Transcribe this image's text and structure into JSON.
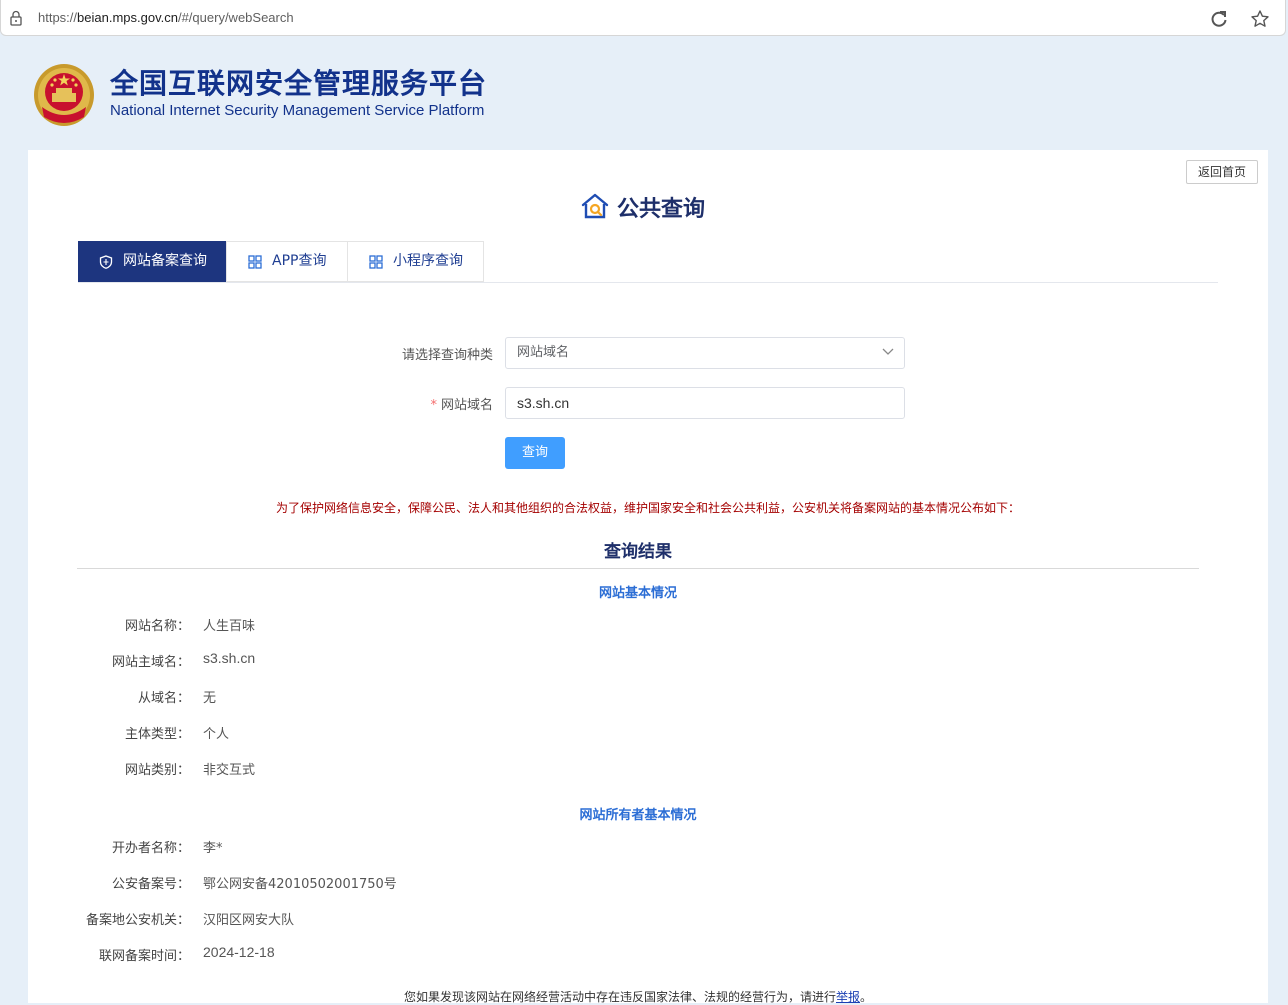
{
  "browser": {
    "url_prefix": "https://",
    "url_host": "beian.mps.gov.cn",
    "url_path": "/#/query/webSearch"
  },
  "header": {
    "title": "全国互联网安全管理服务平台",
    "subtitle": "National Internet Security Management Service Platform"
  },
  "card": {
    "home_button": "返回首页",
    "heading": "公共查询"
  },
  "tabs": [
    {
      "label": "网站备案查询",
      "active": true,
      "icon": "shield-icon"
    },
    {
      "label": "APP查询",
      "active": false,
      "icon": "grid-icon"
    },
    {
      "label": "小程序查询",
      "active": false,
      "icon": "grid-icon"
    }
  ],
  "form": {
    "type_label": "请选择查询种类",
    "type_value": "网站域名",
    "domain_label": "网站域名",
    "domain_required_mark": "*",
    "domain_value": "s3.sh.cn",
    "submit": "查询"
  },
  "notice": "为了保护网络信息安全，保障公民、法人和其他组织的合法权益，维护国家安全和社会公共利益，公安机关将备案网站的基本情况公布如下：",
  "result": {
    "title": "查询结果",
    "website_section": {
      "title": "网站基本情况",
      "rows": [
        {
          "label": "网站名称：",
          "value": "人生百味"
        },
        {
          "label": "网站主域名：",
          "value": "s3.sh.cn"
        },
        {
          "label": "从域名：",
          "value": "无"
        },
        {
          "label": "主体类型：",
          "value": "个人"
        },
        {
          "label": "网站类别：",
          "value": "非交互式"
        }
      ]
    },
    "owner_section": {
      "title": "网站所有者基本情况",
      "rows": [
        {
          "label": "开办者名称：",
          "value": "李*"
        },
        {
          "label": "公安备案号：",
          "value": "鄂公网安备42010502001750号"
        },
        {
          "label": "备案地公安机关：",
          "value": "汉阳区网安大队"
        },
        {
          "label": "联网备案时间：",
          "value": "2024-12-18"
        }
      ]
    }
  },
  "footer": {
    "text": "您如果发现该网站在网络经营活动中存在违反国家法律、法规的经营行为，请进行",
    "link": "举报",
    "end": "。"
  },
  "colors": {
    "brand_navy": "#1d357f",
    "title_blue": "#12328b",
    "section_blue": "#2c6ed5",
    "notice_red": "#a40000",
    "button_blue": "#409eff"
  }
}
